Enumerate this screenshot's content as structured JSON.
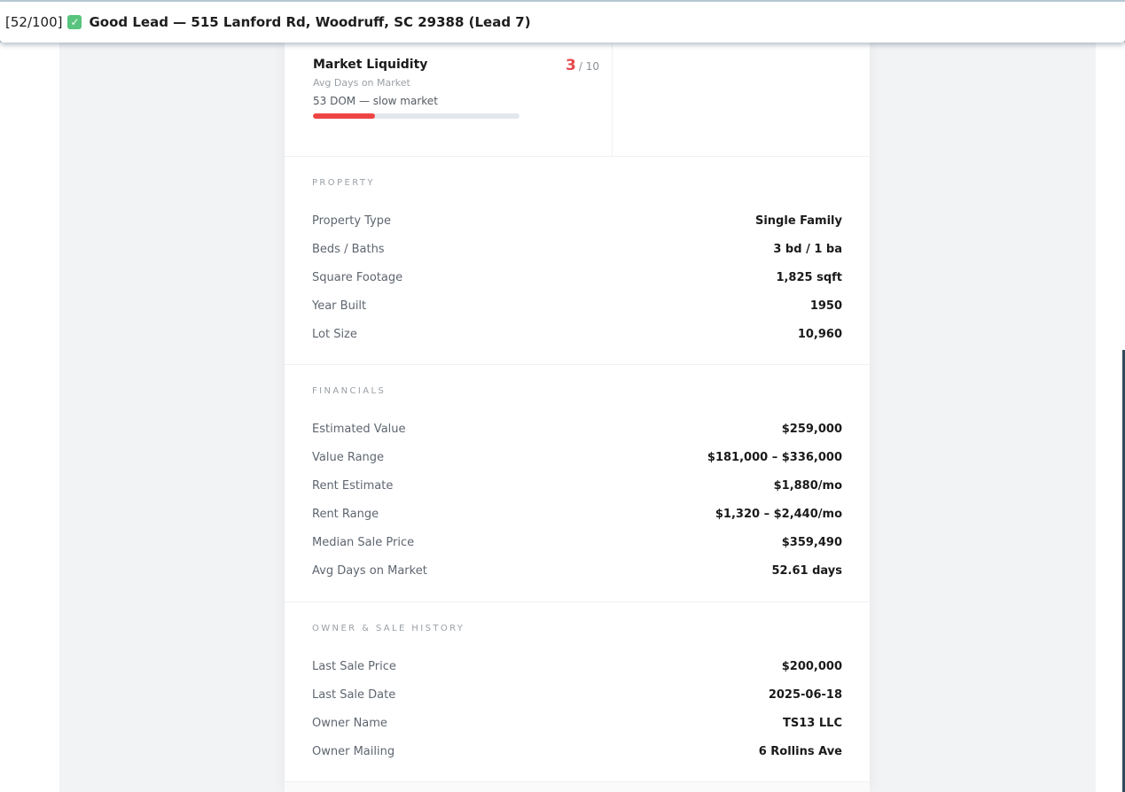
{
  "window": {
    "counter": "[52/100]",
    "title": "Good Lead — 515 Lanford Rd, Woodruff, SC 29388 (Lead 7)"
  },
  "score_card": {
    "title": "Market Liquidity",
    "score": "3",
    "max": "/ 10",
    "subtitle": "Avg Days on Market",
    "description": "53 DOM — slow market",
    "bar_fraction": 0.3,
    "bar_color": "#ef4444"
  },
  "property": {
    "title": "PROPERTY",
    "rows": [
      {
        "label": "Property Type",
        "value": "Single Family"
      },
      {
        "label": "Beds / Baths",
        "value": "3 bd / 1 ba"
      },
      {
        "label": "Square Footage",
        "value": "1,825 sqft"
      },
      {
        "label": "Year Built",
        "value": "1950"
      },
      {
        "label": "Lot Size",
        "value": "10,960"
      }
    ]
  },
  "financials": {
    "title": "FINANCIALS",
    "rows": [
      {
        "label": "Estimated Value",
        "value": "$259,000"
      },
      {
        "label": "Value Range",
        "value": "$181,000 – $336,000"
      },
      {
        "label": "Rent Estimate",
        "value": "$1,880/mo"
      },
      {
        "label": "Rent Range",
        "value": "$1,320 – $2,440/mo"
      },
      {
        "label": "Median Sale Price",
        "value": "$359,490"
      },
      {
        "label": "Avg Days on Market",
        "value": "52.61 days"
      }
    ]
  },
  "owner": {
    "title": "OWNER & SALE HISTORY",
    "rows": [
      {
        "label": "Last Sale Price",
        "value": "$200,000"
      },
      {
        "label": "Last Sale Date",
        "value": "2025-06-18"
      },
      {
        "label": "Owner Name",
        "value": "TS13 LLC"
      },
      {
        "label": "Owner Mailing",
        "value": "6 Rollins Ave"
      }
    ]
  }
}
